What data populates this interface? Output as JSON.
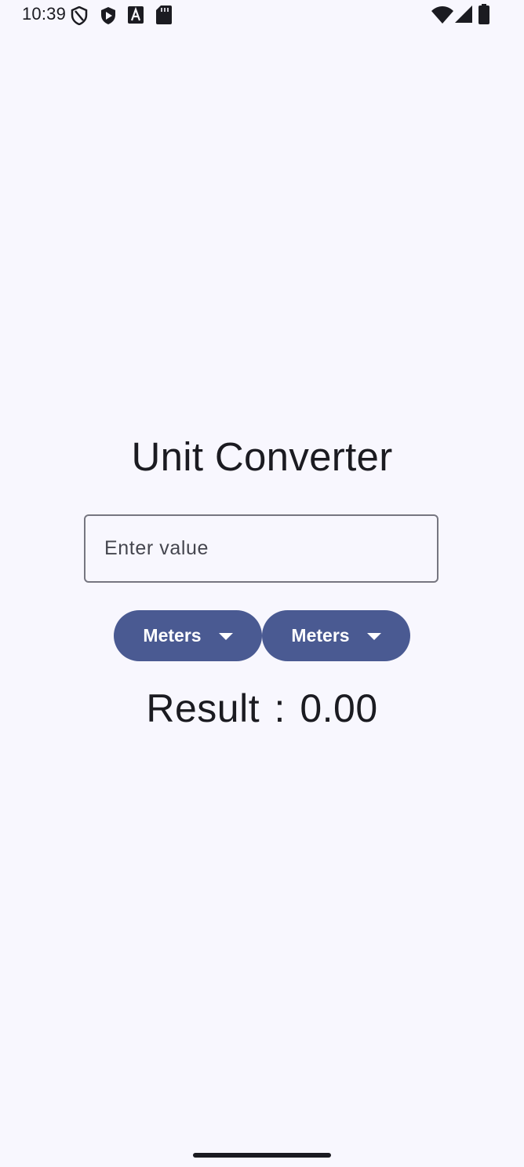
{
  "status_bar": {
    "time": "10:39",
    "icons": [
      "vpn-shield-icon",
      "play-protect-icon",
      "font-a-icon",
      "sd-card-icon",
      "wifi-icon",
      "signal-icon",
      "battery-icon"
    ]
  },
  "app": {
    "title": "Unit Converter",
    "input": {
      "placeholder": "Enter value",
      "value": ""
    },
    "from_unit": "Meters",
    "to_unit": "Meters",
    "result": {
      "label": "Result",
      "separator": ":",
      "value": "0.00"
    }
  },
  "colors": {
    "background": "#f8f7fe",
    "accent": "#4a5a92",
    "text": "#1b1b21",
    "outline": "#767680"
  }
}
